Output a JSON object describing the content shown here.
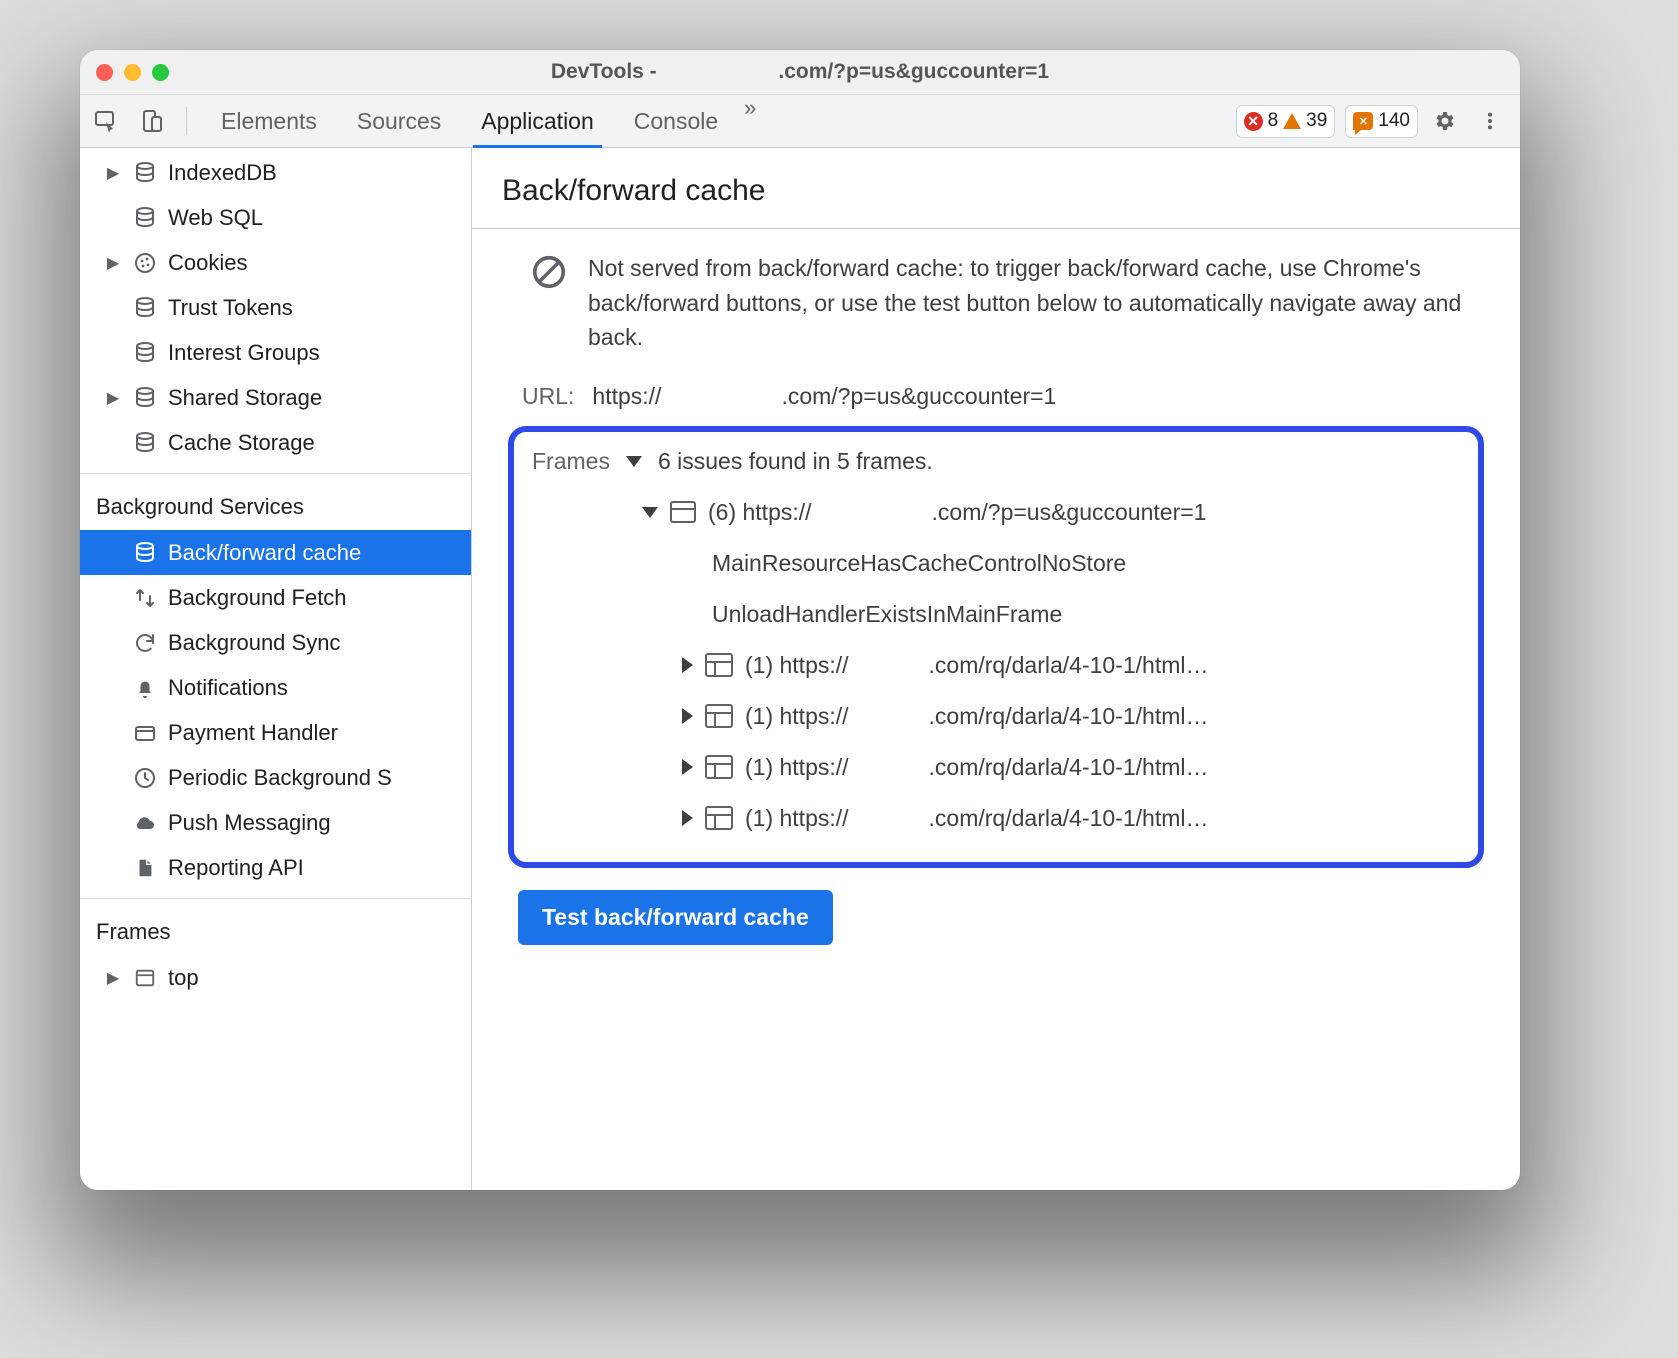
{
  "titlebar": {
    "prefix": "DevTools -",
    "suffix": ".com/?p=us&guccounter=1"
  },
  "toolbar": {
    "tabs": [
      "Elements",
      "Sources",
      "Application",
      "Console"
    ],
    "activeIndex": 2,
    "errors": 8,
    "warnings": 39,
    "messages": 140
  },
  "sidebar": {
    "storage": [
      {
        "label": "IndexedDB",
        "icon": "database",
        "expand": true
      },
      {
        "label": "Web SQL",
        "icon": "database"
      },
      {
        "label": "Cookies",
        "icon": "cookies",
        "expand": true
      },
      {
        "label": "Trust Tokens",
        "icon": "database"
      },
      {
        "label": "Interest Groups",
        "icon": "database"
      },
      {
        "label": "Shared Storage",
        "icon": "database",
        "expand": true
      },
      {
        "label": "Cache Storage",
        "icon": "database"
      }
    ],
    "bgHeading": "Background Services",
    "bgItems": [
      {
        "label": "Back/forward cache",
        "icon": "database",
        "selected": true
      },
      {
        "label": "Background Fetch",
        "icon": "swap"
      },
      {
        "label": "Background Sync",
        "icon": "sync"
      },
      {
        "label": "Notifications",
        "icon": "bell"
      },
      {
        "label": "Payment Handler",
        "icon": "card"
      },
      {
        "label": "Periodic Background Sync",
        "icon": "clock",
        "truncated": "Periodic Background S"
      },
      {
        "label": "Push Messaging",
        "icon": "cloud"
      },
      {
        "label": "Reporting API",
        "icon": "file"
      }
    ],
    "framesHeading": "Frames",
    "framesItems": [
      {
        "label": "top",
        "icon": "frame",
        "expand": true
      }
    ]
  },
  "main": {
    "heading": "Back/forward cache",
    "status": "Not served from back/forward cache: to trigger back/forward cache, use Chrome's back/forward buttons, or use the test button below to automatically navigate away and back.",
    "urlLabel": "URL:",
    "urlPrefix": "https://",
    "urlSuffix": ".com/?p=us&guccounter=1",
    "framesLabel": "Frames",
    "framesSummary": "6 issues found in 5 frames.",
    "rootPrefix": "(6) https://",
    "rootSuffix": ".com/?p=us&guccounter=1",
    "reasons": [
      "MainResourceHasCacheControlNoStore",
      "UnloadHandlerExistsInMainFrame"
    ],
    "children": [
      {
        "prefix": "(1) https://",
        "suffix": ".com/rq/darla/4-10-1/html…"
      },
      {
        "prefix": "(1) https://",
        "suffix": ".com/rq/darla/4-10-1/html…"
      },
      {
        "prefix": "(1) https://",
        "suffix": ".com/rq/darla/4-10-1/html…"
      },
      {
        "prefix": "(1) https://",
        "suffix": ".com/rq/darla/4-10-1/html…"
      }
    ],
    "testButton": "Test back/forward cache"
  }
}
